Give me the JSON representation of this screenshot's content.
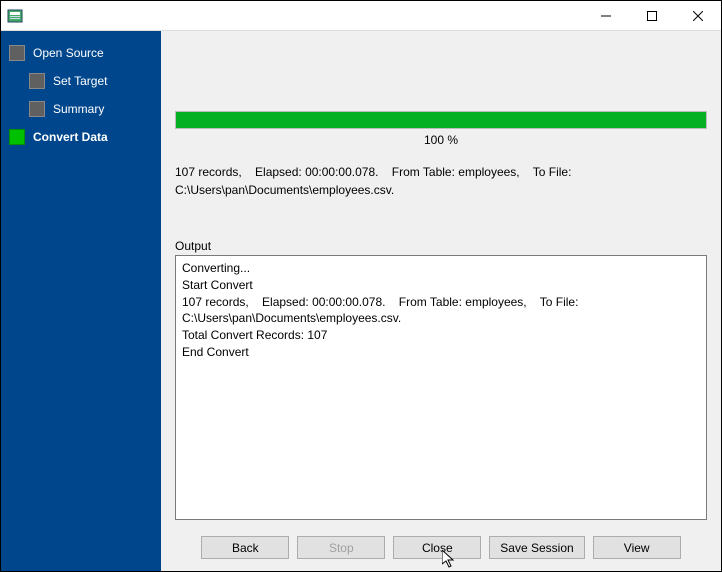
{
  "window": {
    "title": ""
  },
  "sidebar": {
    "items": [
      {
        "label": "Open Source",
        "active": false
      },
      {
        "label": "Set Target",
        "active": false
      },
      {
        "label": "Summary",
        "active": false
      },
      {
        "label": "Convert Data",
        "active": true
      }
    ]
  },
  "progress": {
    "percent_label": "100 %",
    "fill_color": "#06B025",
    "value": 100
  },
  "status": {
    "text": "107 records,    Elapsed: 00:00:00.078.    From Table: employees,    To File: C:\\Users\\pan\\Documents\\employees.csv."
  },
  "output": {
    "label": "Output",
    "lines": [
      "Converting...",
      "Start Convert",
      "107 records,    Elapsed: 00:00:00.078.    From Table: employees,    To File: C:\\Users\\pan\\Documents\\employees.csv.",
      "Total Convert Records: 107",
      "End Convert"
    ]
  },
  "buttons": {
    "back": "Back",
    "stop": "Stop",
    "close": "Close",
    "save_session": "Save Session",
    "view": "View"
  }
}
